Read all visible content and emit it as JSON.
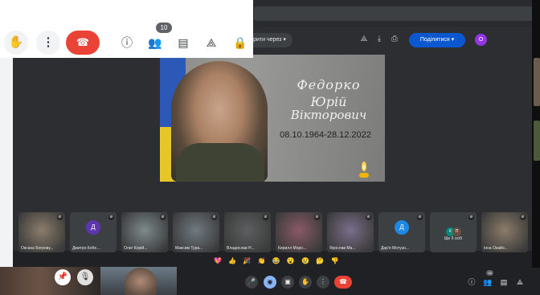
{
  "outer_controls": {
    "raise_hand_icon": "✋",
    "more_icon": "⋮",
    "leave_icon": "☎",
    "info_icon": "ⓘ",
    "people_icon": "👥",
    "people_count": "10",
    "chat_icon": "▤",
    "activities_icon": "⟁",
    "host_controls_icon": "🔒"
  },
  "shared_screen": {
    "open_with_label": "дкрити через ▾",
    "share_label": "Поділитися ▾",
    "profile_initial": "О",
    "slide": {
      "name_line1": "Федорко",
      "name_line2": "Юрій",
      "name_line3": "Вікторович",
      "dates": "08.10.1964-28.12.2022"
    },
    "participants": [
      {
        "label": "Оксана Богрову...",
        "kind": "photo",
        "color": "#8b7d6b"
      },
      {
        "label": "Дмитро Кобе...",
        "kind": "avatar",
        "initial": "Д",
        "color": "#5e35b1"
      },
      {
        "label": "Олег Корій...",
        "kind": "photo",
        "color": "#7d8a8c"
      },
      {
        "label": "Максим Тура...",
        "kind": "photo",
        "color": "#6f7a80"
      },
      {
        "label": "Владислав Н...",
        "kind": "photo",
        "color": "#5d5f60"
      },
      {
        "label": "Кирилл Моро...",
        "kind": "photo",
        "color": "#8a5a66"
      },
      {
        "label": "Ярослав Ма...",
        "kind": "photo",
        "color": "#7a6e8a"
      },
      {
        "label": "Дар'я Мотузо...",
        "kind": "avatar",
        "initial": "Д",
        "color": "#1e88e5"
      },
      {
        "label": "Ще 6 осіб",
        "kind": "more",
        "initial": "К",
        "initial2": "П",
        "color": "#00897b",
        "color2": "#6d4c41"
      },
      {
        "label": "Інна Окайо...",
        "kind": "photo",
        "color": "#8c7c6a"
      }
    ],
    "reactions": "💖 👍 🎉 👏 😂 😮 😢 🤔 👎",
    "bottom_bar": {
      "mic_icon": "🎤",
      "cam_icon": "◉",
      "present_icon": "▣",
      "hand_icon": "✋",
      "more_icon": "⋮",
      "leave_icon": "☎",
      "info_icon": "ⓘ",
      "people_icon": "👥",
      "people_count": "16",
      "chat_icon": "▤",
      "activities_icon": "⟁"
    }
  },
  "self_view": {
    "pin_icon": "📌",
    "mute_icon": "🎙"
  }
}
